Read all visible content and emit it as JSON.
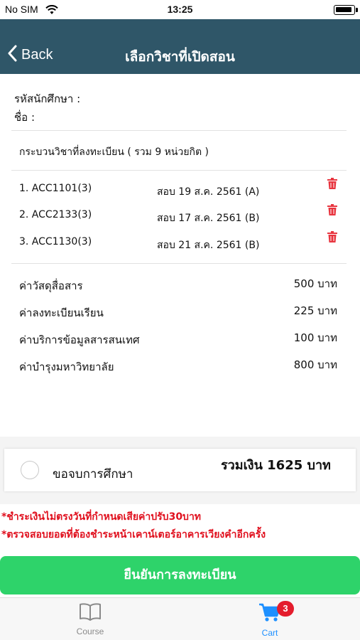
{
  "status_bar": {
    "carrier": "No SIM",
    "time": "13:25"
  },
  "nav": {
    "back_label": "Back",
    "title": "เลือกวิชาที่เปิดสอน"
  },
  "student": {
    "id_label": "รหัสนักศึกษา :",
    "name_label": "ชื่อ :"
  },
  "courses": {
    "section_title": "กระบวนวิชาที่ลงทะเบียน ( รวม 9 หน่วยกิต )",
    "items": [
      {
        "code": "1. ACC1101(3)",
        "exam": "สอบ 19 ส.ค. 2561 (A)"
      },
      {
        "code": "2. ACC2133(3)",
        "exam": "สอบ 17 ส.ค. 2561 (B)"
      },
      {
        "code": "3. ACC1130(3)",
        "exam": "สอบ 21 ส.ค. 2561 (B)"
      }
    ]
  },
  "fees": [
    {
      "label": "ค่าวัสดุสื่อสาร",
      "amount": "500 บาท"
    },
    {
      "label": "ค่าลงทะเบียนเรียน",
      "amount": "225 บาท"
    },
    {
      "label": "ค่าบริการข้อมูลสารสนเทศ",
      "amount": "100 บาท"
    },
    {
      "label": "ค่าบำรุงมหาวิทยาลัย",
      "amount": "800 บาท"
    }
  ],
  "graduation": {
    "label": "ขอจบการศึกษา",
    "checked": false
  },
  "total": "รวมเงิน 1625 บาท",
  "notices": [
    "*ชำระเงินไม่ตรงวันที่กำหนดเสียค่าปรับ30บาท",
    "*ตรวจสอบยอดที่ต้องชำระหน้าเคาน์เตอร์อาคารเวียงคำอีกครั้ง"
  ],
  "confirm_label": "ยืนยันการลงทะเบียน",
  "tabs": [
    {
      "label": "Course",
      "icon": "book-icon",
      "active": false
    },
    {
      "label": "Cart",
      "icon": "cart-icon",
      "active": true,
      "badge": "3"
    }
  ],
  "colors": {
    "nav": "#2f5668",
    "accent": "#1e90ff",
    "danger": "#e0101e",
    "confirm": "#2ed36a"
  }
}
